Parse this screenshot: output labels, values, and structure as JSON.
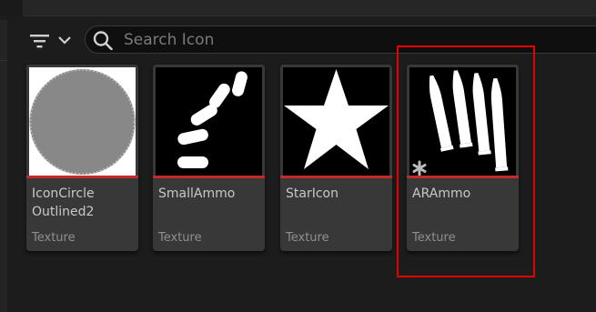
{
  "toolbar": {
    "filter_icon": "filter-lines-icon",
    "chevron_icon": "chevron-down-icon"
  },
  "search": {
    "placeholder": "Search Icon",
    "value": "",
    "icon": "search-icon"
  },
  "assets": [
    {
      "name": "IconCircle\nOutlined2",
      "type": "Texture",
      "thumbnail": "gray-circle"
    },
    {
      "name": "SmallAmmo",
      "type": "Texture",
      "thumbnail": "arc-of-bullets"
    },
    {
      "name": "StarIcon",
      "type": "Texture",
      "thumbnail": "white-star"
    },
    {
      "name": "ARAmmo",
      "type": "Texture",
      "thumbnail": "rifle-rounds",
      "highlighted": true
    }
  ],
  "colors": {
    "background": "#1c1c1c",
    "card": "#383838",
    "asset_type_bar": "#c32a2a",
    "highlight": "#e60000"
  }
}
